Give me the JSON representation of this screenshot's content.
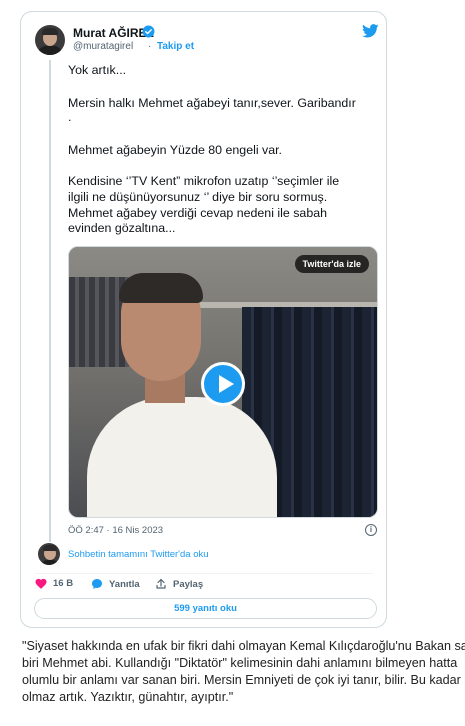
{
  "tweet": {
    "author_name": "Murat AĞIREL",
    "handle": "@muratagirel",
    "separator": "·",
    "follow_label": "Takip et",
    "lines": [
      "Yok artık...",
      "Mersin halkı Mehmet ağabeyi tanır,sever. Garibandır",
      ".",
      "Mehmet ağabeyin Yüzde 80 engeli var.",
      "Kendisine ‘’TV Kent” mikrofon uzatıp ‘’seçimler ile",
      "ilgili ne düşünüyorsunuz ‘’  diye bir soru sormuş.",
      "Mehmet ağabey verdiği cevap nedeni ile sabah",
      "evinden gözaltına..."
    ],
    "video_overlay_label": "Twitter'da izle",
    "timestamp": "ÖÖ 2:47 · 16 Nis 2023",
    "info_glyph": "i",
    "conversation_link": "Sohbetin tamamını Twitter'da oku",
    "actions": {
      "likes": "16 B",
      "reply": "Yanıtla",
      "share": "Paylaş"
    },
    "replies_button": "599 yanıtı oku",
    "colors": {
      "accent": "#1d9bf0",
      "like": "#f91880",
      "text": "#0f1419",
      "muted": "#536471"
    }
  },
  "caption": {
    "lines": [
      "\"Siyaset hakkında en ufak bir fikri dahi olmayan Kemal Kılıçdaroğlu'nu Bakan sa",
      "biri Mehmet abi. Kullandığı \"Diktatör\" kelimesinin dahi anlamını bilmeyen hatta",
      "olumlu bir anlamı var sanan biri. Mersin Emniyeti de çok iyi tanır, bilir. Bu kadar",
      "olmaz artık. Yazıktır, günahtır, ayıptır.\""
    ]
  }
}
